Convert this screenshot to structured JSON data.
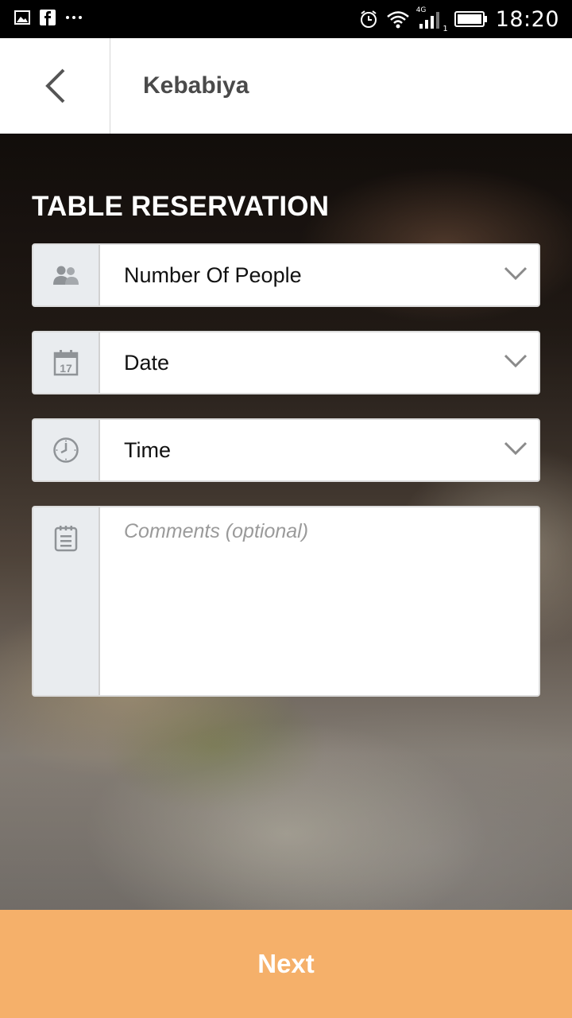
{
  "status_bar": {
    "time": "18:20",
    "network": "4G",
    "sim_slot": "1",
    "icons": [
      "image-icon",
      "facebook-icon",
      "more-icon",
      "alarm-icon",
      "wifi-icon",
      "signal-icon",
      "battery-icon"
    ]
  },
  "header": {
    "title": "Kebabiya",
    "back_icon": "chevron-left-icon"
  },
  "reservation": {
    "title": "TABLE RESERVATION",
    "people": {
      "label": "Number Of People",
      "icon": "people-icon"
    },
    "date": {
      "label": "Date",
      "icon": "calendar-icon",
      "icon_day": "17"
    },
    "time": {
      "label": "Time",
      "icon": "clock-icon"
    },
    "comments": {
      "placeholder": "Comments (optional)",
      "value": "",
      "icon": "notepad-icon"
    }
  },
  "footer": {
    "next_label": "Next"
  },
  "colors": {
    "accent": "#f5b06a",
    "header_bg": "#ffffff",
    "icon_cell_bg": "#e9ecef"
  }
}
